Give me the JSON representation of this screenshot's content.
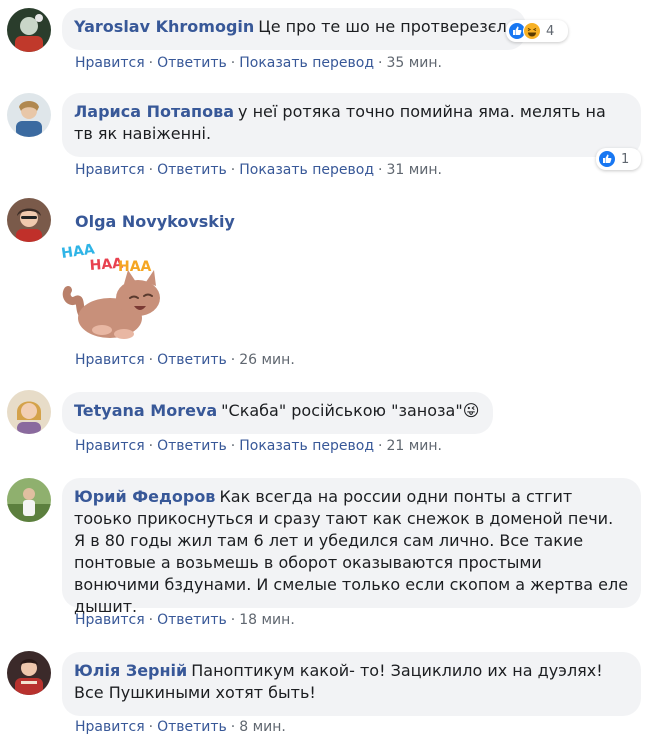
{
  "actions": {
    "like": "Нравится",
    "reply": "Ответить",
    "translate": "Показать перевод",
    "sep": "·"
  },
  "colors": {
    "author_link": "#385898",
    "bubble_bg": "#f2f3f5",
    "meta_text": "#606770",
    "like_blue": "#1877f2",
    "haha_yellow": "#f7b125"
  },
  "comments": [
    {
      "author": "Yaroslav Khromogin",
      "text": "Це про те шо не протверезєл",
      "time": "35 мин.",
      "reactions": {
        "icons": [
          "like-icon",
          "haha-icon"
        ],
        "count": "4"
      }
    },
    {
      "author": "Лариса Потапова",
      "text": "у неї ротяка точно помийна яма. мелять на тв як навіженні.",
      "time": "31 мин.",
      "reactions": {
        "icons": [
          "like-icon"
        ],
        "count": "1"
      }
    },
    {
      "author": "Olga Novykovskiy",
      "sticker": {
        "icon": "haha-cat-sticker",
        "text": [
          "HAA",
          "HAA",
          "HAA"
        ]
      },
      "time": "26 мин."
    },
    {
      "author": "Tetyana Moreva",
      "text": "\"Скаба\" російською \"заноза\"😜",
      "time": "21 мин."
    },
    {
      "author": "Юрий Федоров",
      "text": "Как всегда на россии одни понты а стгит тооько прикоснуться и сразу тают как снежок в доменой печи. Я в 80 годы жил там 6 лет и убедился сам лично. Все такие понтовые а возьмешь в оборот оказываются простыми вонючими бздунами. И смелые только если скопом а жертва еле дышит.",
      "time": "18 мин."
    },
    {
      "author": "Юлія Зерній",
      "text": "Паноптикум какой- то! Зациклило их на дуэлях! Все Пушкиными хотят быть!",
      "time": "8 мин."
    }
  ]
}
